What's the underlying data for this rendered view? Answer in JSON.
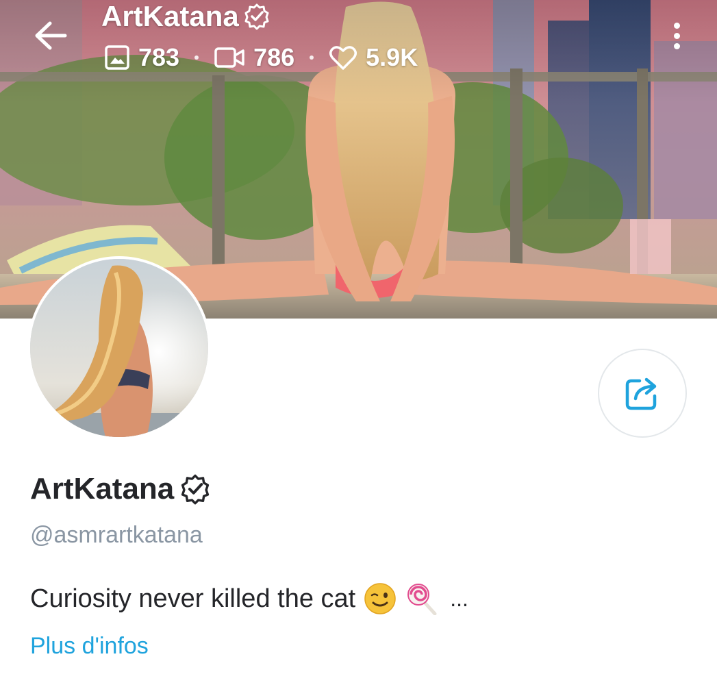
{
  "header": {
    "title": "ArtKatana",
    "stats": [
      {
        "icon": "image-icon",
        "value": "783"
      },
      {
        "icon": "video-icon",
        "value": "786"
      },
      {
        "icon": "heart-icon",
        "value": "5.9K"
      }
    ]
  },
  "profile": {
    "display_name": "ArtKatana",
    "handle": "@asmrartkatana",
    "bio": "Curiosity never killed the cat",
    "bio_suffix": "...",
    "more_info": "Plus d'infos"
  },
  "colors": {
    "accent": "#1fa3dd",
    "text_primary": "#242529",
    "text_secondary": "#8a96a3"
  }
}
